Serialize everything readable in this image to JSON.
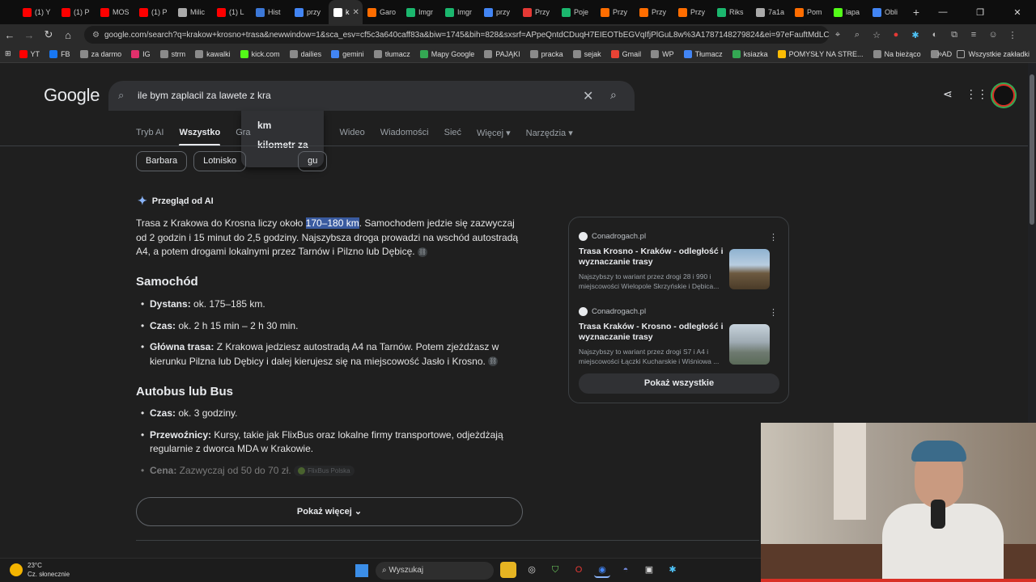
{
  "browser": {
    "tabs": [
      {
        "label": "(1) Y",
        "color": "#ff0000"
      },
      {
        "label": "(1) P",
        "color": "#ff0000"
      },
      {
        "label": "MOS",
        "color": "#ff0000"
      },
      {
        "label": "(1) P",
        "color": "#ff0000"
      },
      {
        "label": "Milic",
        "color": "#aaaaaa"
      },
      {
        "label": "(1) L",
        "color": "#ff0000"
      },
      {
        "label": "Hist",
        "color": "#3c78d8"
      },
      {
        "label": "przy",
        "color": "#4285f4"
      },
      {
        "label": "k",
        "color": "#ffffff"
      },
      {
        "label": "Garo",
        "color": "#ff6d00"
      },
      {
        "label": "Imgr",
        "color": "#1bb76e"
      },
      {
        "label": "Imgr",
        "color": "#1bb76e"
      },
      {
        "label": "przy",
        "color": "#4285f4"
      },
      {
        "label": "Przy",
        "color": "#e53935"
      },
      {
        "label": "Poje",
        "color": "#1bb76e"
      },
      {
        "label": "Przy",
        "color": "#ff6d00"
      },
      {
        "label": "Przy",
        "color": "#ff6d00"
      },
      {
        "label": "Przy",
        "color": "#ff6d00"
      },
      {
        "label": "Riks",
        "color": "#1bb76e"
      },
      {
        "label": "7a1a",
        "color": "#aaaaaa"
      },
      {
        "label": "Pom",
        "color": "#ff6d00"
      },
      {
        "label": "lapa",
        "color": "#53fc18"
      },
      {
        "label": "Obli",
        "color": "#4285f4"
      }
    ],
    "url": "google.com/search?q=krakow+krosno+trasa&newwindow=1&sca_esv=cf5c3a640caff83a&biw=1745&bih=828&sxsrf=APpeQntdCDuqH7EIEOTbEGVqIfjPlGuL8w%3A1787148279824&ei=97eFauftMdLCwPAP54aP0A..."
  },
  "bookmarks": {
    "items": [
      {
        "label": "YT",
        "color": "#ff0000"
      },
      {
        "label": "FB",
        "color": "#1877f2"
      },
      {
        "label": "za darmo",
        "color": "#8a8a8a"
      },
      {
        "label": "IG",
        "color": "#e1306c"
      },
      {
        "label": "strm",
        "color": "#8a8a8a"
      },
      {
        "label": "kawalki",
        "color": "#8a8a8a"
      },
      {
        "label": "kick.com",
        "color": "#53fc18"
      },
      {
        "label": "dailies",
        "color": "#8a8a8a"
      },
      {
        "label": "gemini",
        "color": "#4285f4"
      },
      {
        "label": "tłumacz",
        "color": "#8a8a8a"
      },
      {
        "label": "Mapy Google",
        "color": "#34a853"
      },
      {
        "label": "PAJĄKI",
        "color": "#8a8a8a"
      },
      {
        "label": "pracka",
        "color": "#8a8a8a"
      },
      {
        "label": "sejak",
        "color": "#8a8a8a"
      },
      {
        "label": "Gmail",
        "color": "#ea4335"
      },
      {
        "label": "WP",
        "color": "#8a8a8a"
      },
      {
        "label": "Tłumacz",
        "color": "#4285f4"
      },
      {
        "label": "ksiazka",
        "color": "#34a853"
      },
      {
        "label": "POMYSŁY NA STRE...",
        "color": "#fbbc04"
      },
      {
        "label": "Na bieżąco",
        "color": "#8a8a8a"
      },
      {
        "label": "AD",
        "color": "#8a8a8a"
      }
    ],
    "all_label": "Wszystkie zakładki"
  },
  "google": {
    "logo": "Google",
    "query": "ile bym zaplacil za lawete z kra",
    "suggestions": [
      "km",
      "kilometr za"
    ],
    "tabs": [
      "Tryb AI",
      "Wszystko",
      "Gra",
      "",
      "",
      "Wideo",
      "Wiadomości",
      "Sieć",
      "Więcej ▾",
      "Narzędzia ▾"
    ],
    "chips": [
      "Barbara",
      "Lotnisko",
      "gu"
    ],
    "ai_heading": "Przegląd od AI",
    "ai_intro_pre": "Trasa z Krakowa do Krosna liczy około ",
    "ai_intro_hl": "170–180 km",
    "ai_intro_post": ". Samochodem jedzie się zazwyczaj od 2 godzin i 15 minut do 2,5 godziny. Najszybsza droga prowadzi na wschód autostradą A4, a potem drogami lokalnymi przez Tarnów i Pilzno lub Dębicę.",
    "section_car": "Samochód",
    "car": [
      {
        "k": "Dystans:",
        "v": " ok. 175–185 km."
      },
      {
        "k": "Czas:",
        "v": " ok. 2 h 15 min – 2 h 30 min."
      },
      {
        "k": "Główna trasa:",
        "v": " Z Krakowa jedziesz autostradą A4 na Tarnów. Potem zjeżdżasz w kierunku Pilzna lub Dębicy i dalej kierujesz się na miejscowość Jasło i Krosno."
      }
    ],
    "section_bus": "Autobus lub Bus",
    "bus": [
      {
        "k": "Czas:",
        "v": " ok. 3 godziny."
      },
      {
        "k": "Przewoźnicy:",
        "v": " Kursy, takie jak FlixBus oraz lokalne firmy transportowe, odjeżdżają regularnie z dworca MDA w Krakowie."
      },
      {
        "k": "Cena:",
        "v": " Zazwyczaj od 50 do 70 zł."
      }
    ],
    "flixbus_pill": "FlixBus Polska",
    "show_more": "Pokaż więcej",
    "sources": [
      {
        "site": "Conadrogach.pl",
        "title": "Trasa Krosno - Kraków - odległość i wyznaczanie trasy",
        "desc": "Najszybszy to wariant przez drogi 28 i 990 i miejscowości Wielopole Skrzyńskie i Dębica..."
      },
      {
        "site": "Conadrogach.pl",
        "title": "Trasa Kraków - Krosno - odległość i wyznaczanie trasy",
        "desc": "Najszybszy to wariant przez drogi S7 i A4 i miejscowości Łączki Kucharskie i Wiśniowa ..."
      }
    ],
    "show_all": "Pokaż wszystkie"
  },
  "taskbar": {
    "temp": "23°C",
    "weather": "Cz. słonecznie",
    "search": "Wyszukaj"
  }
}
